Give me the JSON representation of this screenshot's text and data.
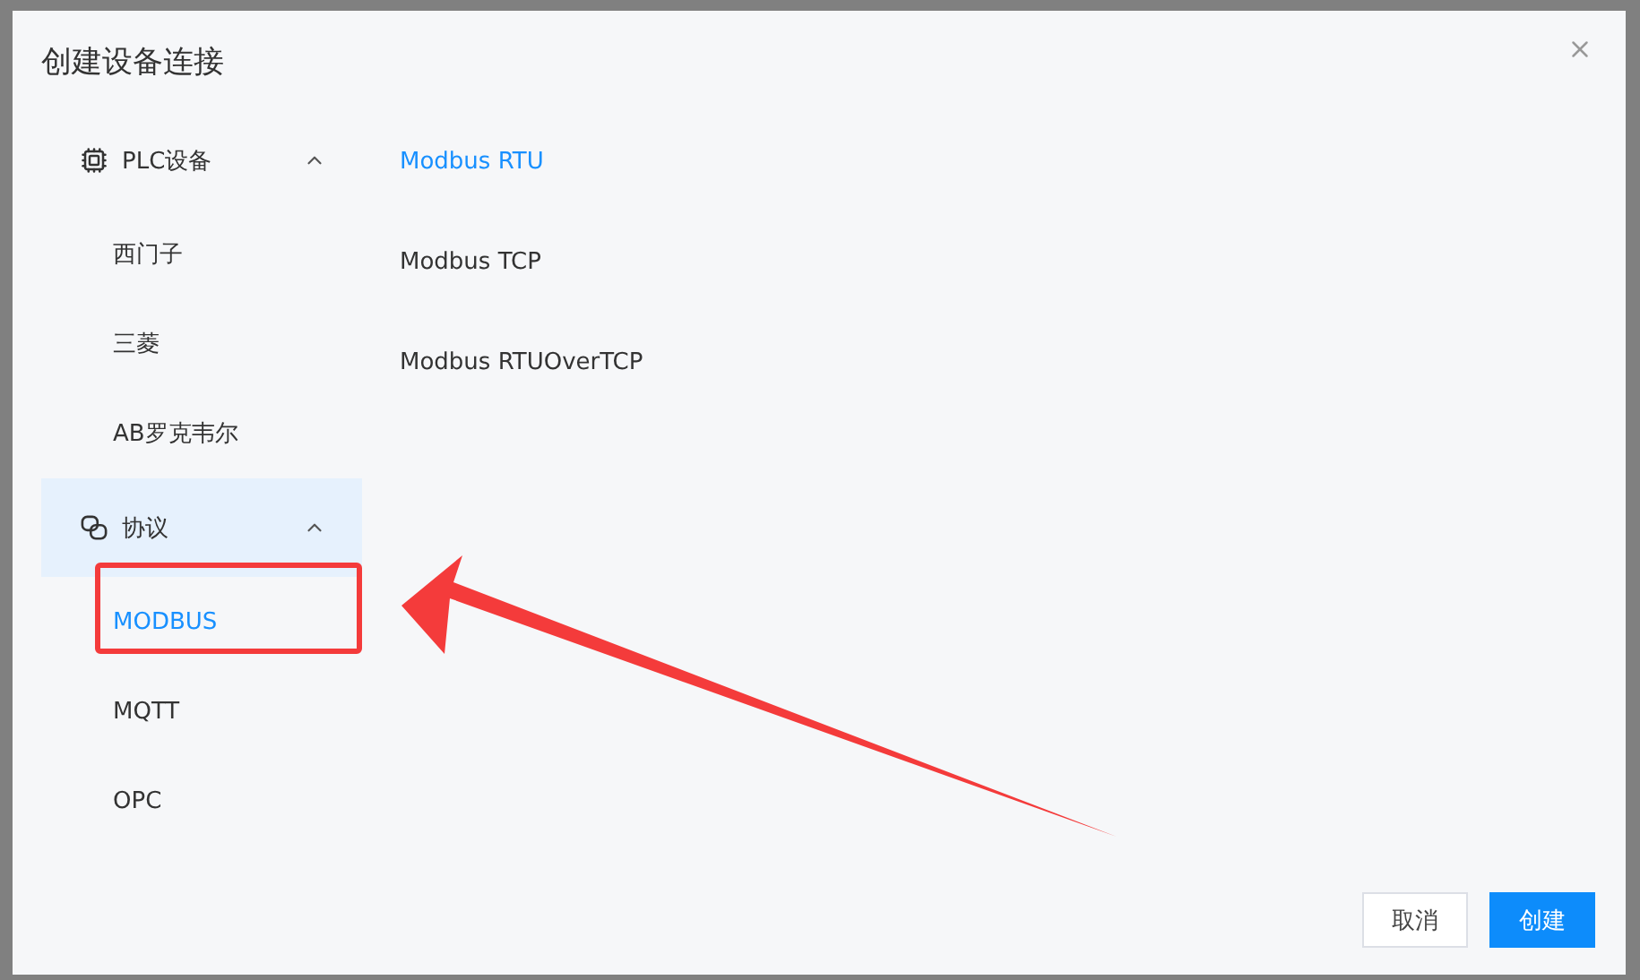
{
  "dialog": {
    "title": "创建设备连接"
  },
  "sidebar": {
    "groups": [
      {
        "label": "PLC设备",
        "kind": "device",
        "expanded": true,
        "selected": false,
        "items": [
          {
            "label": "西门子",
            "selected": false
          },
          {
            "label": "三菱",
            "selected": false
          },
          {
            "label": "AB罗克韦尔",
            "selected": false
          }
        ]
      },
      {
        "label": "协议",
        "kind": "protocol",
        "expanded": true,
        "selected": true,
        "items": [
          {
            "label": "MODBUS",
            "selected": true
          },
          {
            "label": "MQTT",
            "selected": false
          },
          {
            "label": "OPC",
            "selected": false
          }
        ]
      }
    ]
  },
  "options": [
    {
      "label": "Modbus RTU",
      "selected": true
    },
    {
      "label": "Modbus TCP",
      "selected": false
    },
    {
      "label": "Modbus RTUOverTCP",
      "selected": false
    }
  ],
  "buttons": [
    {
      "label": "取消",
      "kind": "secondary"
    },
    {
      "label": "创建",
      "kind": "primary"
    }
  ]
}
